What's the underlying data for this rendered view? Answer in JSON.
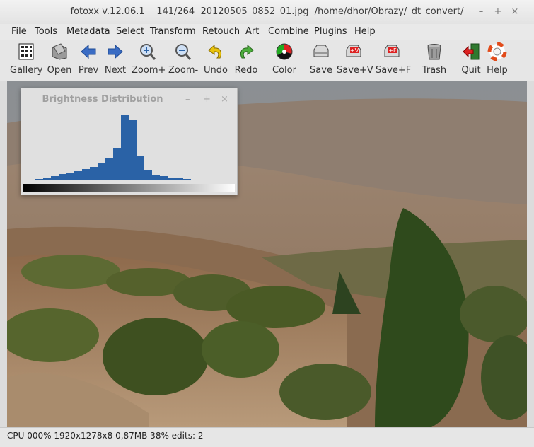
{
  "window": {
    "title": "fotoxx v.12.06.1    141/264  20120505_0852_01.jpg  /home/dhor/Obrazy/_dt_convert/",
    "minimize": "–",
    "maximize": "+",
    "close": "×"
  },
  "menu": [
    "File",
    "Tools",
    "Metadata",
    "Select",
    "Transform",
    "Retouch",
    "Art",
    "Combine",
    "Plugins",
    "Help"
  ],
  "toolbar": [
    {
      "label": "Gallery",
      "icon": "gallery-icon"
    },
    {
      "label": "Open",
      "icon": "open-icon"
    },
    {
      "label": "Prev",
      "icon": "prev-arrow-icon"
    },
    {
      "label": "Next",
      "icon": "next-arrow-icon"
    },
    {
      "label": "Zoom+",
      "icon": "zoom-in-icon"
    },
    {
      "label": "Zoom-",
      "icon": "zoom-out-icon"
    },
    {
      "label": "Undo",
      "icon": "undo-icon"
    },
    {
      "label": "Redo",
      "icon": "redo-icon"
    },
    {
      "label": "Color",
      "icon": "color-wheel-icon"
    },
    {
      "label": "Save",
      "icon": "save-icon"
    },
    {
      "label": "Save+V",
      "icon": "save-version-icon"
    },
    {
      "label": "Save+F",
      "icon": "save-file-icon"
    },
    {
      "label": "Trash",
      "icon": "trash-icon"
    },
    {
      "label": "Quit",
      "icon": "quit-icon"
    },
    {
      "label": "Help",
      "icon": "help-icon"
    }
  ],
  "histogram": {
    "title": "Brightness Distribution",
    "minimize": "–",
    "maximize": "+",
    "close": "×",
    "bar_color": "#2a62a6",
    "bins": [
      0.02,
      0.04,
      0.07,
      0.1,
      0.12,
      0.14,
      0.17,
      0.21,
      0.27,
      0.35,
      0.5,
      1.0,
      0.93,
      0.38,
      0.16,
      0.09,
      0.06,
      0.04,
      0.03,
      0.02,
      0.015,
      0.01
    ]
  },
  "status": {
    "text": "CPU 000%  1920x1278x8 0,87MB 38%  edits: 2"
  }
}
